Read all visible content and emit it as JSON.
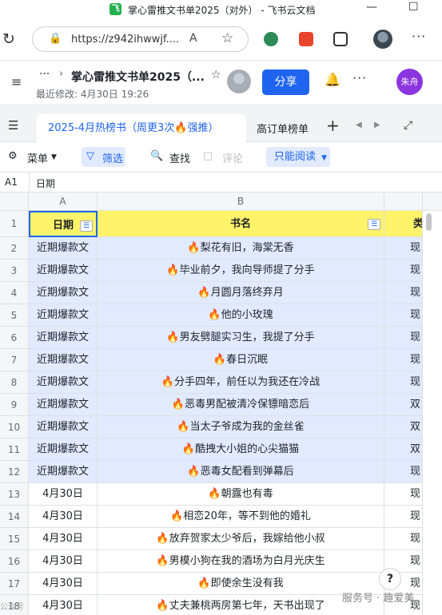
{
  "window": {
    "title": "掌心雷推文书单2025（对外） - 飞书云文档",
    "app_icon": "飞"
  },
  "browser": {
    "url": "https://z942ihwwjf....",
    "reader_label": "A",
    "more": "···"
  },
  "doc": {
    "breadcrumb_dots": "···",
    "title": "掌心雷推文书单2025（...",
    "last_modified": "最近修改: 4月30日 19:26",
    "share_label": "分享",
    "user_initials": "朱舟",
    "more": "···"
  },
  "tabs": {
    "active_label": "2025-4月热榜书（周更3次🔥强推）",
    "second_label": "高订单榜单",
    "add": "+"
  },
  "toolbar": {
    "menu_label": "菜单",
    "filter_label": "筛选",
    "find_label": "查找",
    "comment_label": "评论",
    "readonly_label": "只能阅读"
  },
  "formula_bar": {
    "cell_ref": "A1",
    "content": "日期"
  },
  "grid": {
    "columns": [
      "A",
      "B"
    ],
    "header_row": {
      "num": "1",
      "date": "日期",
      "book": "书名",
      "c": "类"
    },
    "rows": [
      {
        "num": "2",
        "date": "近期爆款文",
        "book": "🔥梨花有旧，海棠无香",
        "c": "现"
      },
      {
        "num": "3",
        "date": "近期爆款文",
        "book": "🔥毕业前夕，我向导师提了分手",
        "c": "现"
      },
      {
        "num": "4",
        "date": "近期爆款文",
        "book": "🔥月圆月落终弃月",
        "c": "现"
      },
      {
        "num": "5",
        "date": "近期爆款文",
        "book": "🔥他的小玫瑰",
        "c": "现"
      },
      {
        "num": "6",
        "date": "近期爆款文",
        "book": "🔥男友劈腿实习生，我提了分手",
        "c": "现"
      },
      {
        "num": "7",
        "date": "近期爆款文",
        "book": "🔥春日沉眠",
        "c": "现"
      },
      {
        "num": "8",
        "date": "近期爆款文",
        "book": "🔥分手四年，前任以为我还在冷战",
        "c": "现"
      },
      {
        "num": "9",
        "date": "近期爆款文",
        "book": "🔥恶毒男配被清冷保镖暗恋后",
        "c": "双"
      },
      {
        "num": "10",
        "date": "近期爆款文",
        "book": "🔥当太子爷成为我的金丝雀",
        "c": "双"
      },
      {
        "num": "11",
        "date": "近期爆款文",
        "book": "🔥酷拽大小姐的心尖猫猫",
        "c": "双"
      },
      {
        "num": "12",
        "date": "近期爆款文",
        "book": "🔥恶毒女配看到弹幕后",
        "c": "现"
      },
      {
        "num": "13",
        "date": "4月30日",
        "book": "🔥朝露也有毒",
        "c": "现"
      },
      {
        "num": "14",
        "date": "4月30日",
        "book": "🔥相恋20年，等不到他的婚礼",
        "c": "现"
      },
      {
        "num": "15",
        "date": "4月30日",
        "book": "🔥放弃贺家太少爷后，我嫁给他小叔",
        "c": "现"
      },
      {
        "num": "16",
        "date": "4月30日",
        "book": "🔥男模小狗在我的酒场为白月光庆生",
        "c": "现"
      },
      {
        "num": "17",
        "date": "4月30日",
        "book": "🔥即使余生没有我",
        "c": "现"
      },
      {
        "num": "18",
        "date": "4月30日",
        "book": "🔥丈夫兼桃两房第七年，天书出现了",
        "c": "现"
      }
    ]
  },
  "overlay": {
    "help": "?",
    "watermark": "服务号 · 趣爱美",
    "watermark_left": "公众号"
  },
  "colors": {
    "accent": "#1e64f0",
    "header_fill": "#fff36b",
    "highlight_row": "#e1eaff",
    "user_avatar": "#8b35e0"
  }
}
